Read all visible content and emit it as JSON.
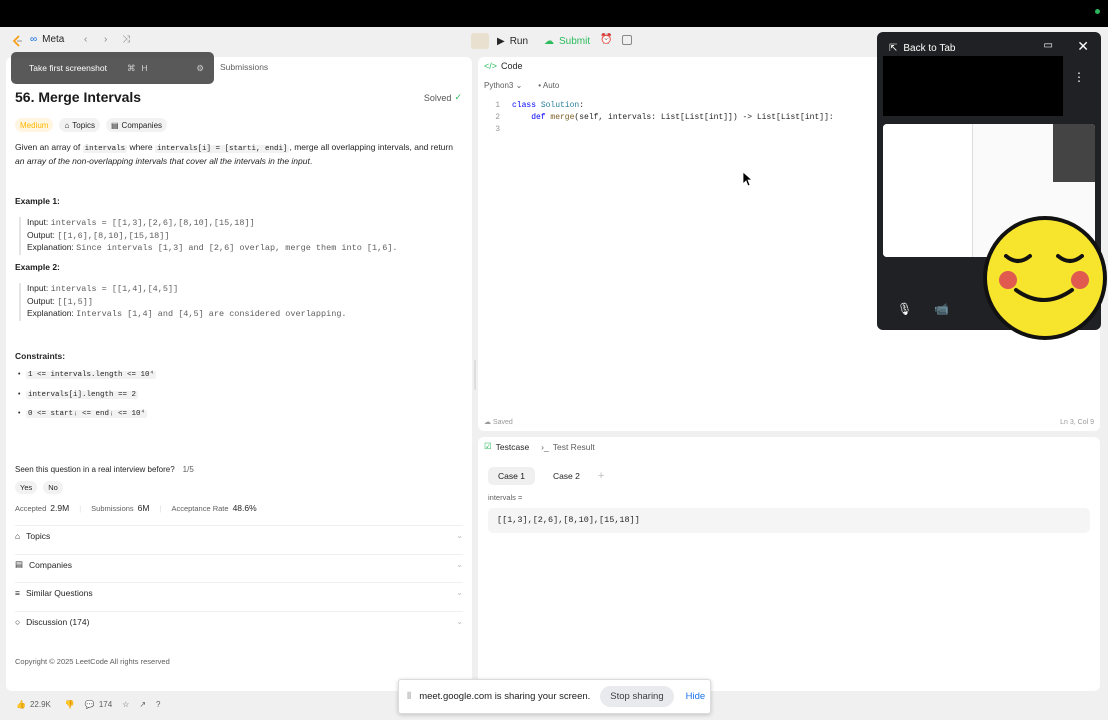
{
  "header": {
    "company": "Meta",
    "run_label": "Run",
    "submit_label": "Submit"
  },
  "tooltip": {
    "text": "Take first screenshot",
    "shortcut_cmd": "⌘",
    "shortcut_key": "H"
  },
  "left_tabs": {
    "submissions": "Submissions"
  },
  "problem": {
    "title": "56. Merge Intervals",
    "status": "Solved",
    "difficulty": "Medium",
    "topics_tag": "Topics",
    "companies_tag": "Companies",
    "desc_1": "Given an array of ",
    "desc_code_1": "intervals",
    "desc_2": " where ",
    "desc_code_2": "intervals[i] = [starti, endi]",
    "desc_3": ", merge all overlapping intervals, and return ",
    "desc_4": "an array of the non-overlapping intervals that cover all the intervals in the input",
    "desc_5": "."
  },
  "examples": [
    {
      "title": "Example 1:",
      "input_label": "Input:",
      "input": "intervals = [[1,3],[2,6],[8,10],[15,18]]",
      "output_label": "Output:",
      "output": "[[1,6],[8,10],[15,18]]",
      "explanation_label": "Explanation:",
      "explanation": "Since intervals [1,3] and [2,6] overlap, merge them into [1,6]."
    },
    {
      "title": "Example 2:",
      "input_label": "Input:",
      "input": "intervals = [[1,4],[4,5]]",
      "output_label": "Output:",
      "output": "[[1,5]]",
      "explanation_label": "Explanation:",
      "explanation": "Intervals [1,4] and [4,5] are considered overlapping."
    }
  ],
  "constraints": {
    "title": "Constraints:",
    "items": [
      "1 <= intervals.length <= 10⁴",
      "intervals[i].length == 2",
      "0 <= startᵢ <= endᵢ <= 10⁴"
    ]
  },
  "interview": {
    "question": "Seen this question in a real interview before?",
    "count": "1/5",
    "yes": "Yes",
    "no": "No"
  },
  "stats": {
    "accepted_label": "Accepted",
    "accepted": "2.9M",
    "submissions_label": "Submissions",
    "submissions": "6M",
    "acceptance_label": "Acceptance Rate",
    "acceptance": "48.6%"
  },
  "sections": {
    "topics": "Topics",
    "companies": "Companies",
    "similar": "Similar Questions",
    "discussion": "Discussion (174)"
  },
  "copyright": "Copyright © 2025 LeetCode All rights reserved",
  "footer": {
    "likes": "22.9K",
    "comments": "174"
  },
  "code": {
    "tab_label": "Code",
    "language": "Python3",
    "mode": "Auto",
    "lines": [
      {
        "num": "1",
        "kw": "class ",
        "cls": "Solution",
        "rest": ":"
      },
      {
        "num": "2",
        "indent": "    ",
        "kw": "def ",
        "fn": "merge",
        "rest": "(self, intervals: List[List[int]]) -> List[List[int]]:"
      },
      {
        "num": "3"
      }
    ],
    "status": "Saved",
    "position": "Ln 3, Col 9"
  },
  "testcase": {
    "tab_label": "Testcase",
    "result_tab": "Test Result",
    "case1": "Case 1",
    "case2": "Case 2",
    "add": "+",
    "var_label": "intervals =",
    "var_value": "[[1,3],[2,6],[8,10],[15,18]]"
  },
  "pip": {
    "back_label": "Back to Tab"
  },
  "share_bar": {
    "message": "meet.google.com is sharing your screen.",
    "stop": "Stop sharing",
    "hide": "Hide"
  },
  "colors": {
    "accent_green": "#2cbb5d",
    "medium": "#ffb800",
    "link_blue": "#1a73e8"
  }
}
